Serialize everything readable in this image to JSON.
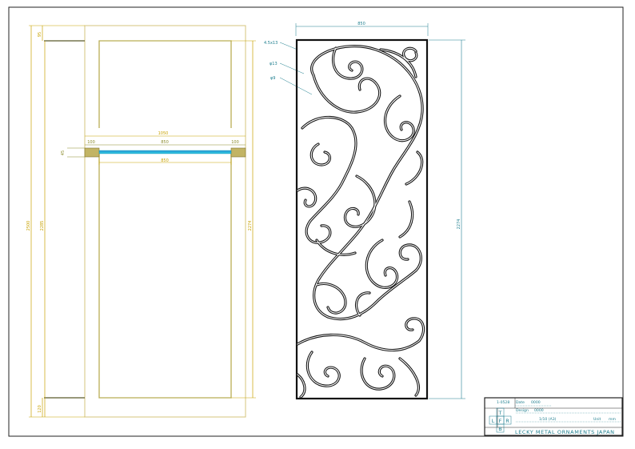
{
  "elevation": {
    "dim_overall_height": "2500",
    "dim_opening_height": "2285",
    "dim_panel_height": "2274",
    "dim_top": "95",
    "dim_bottom": "120",
    "dim_width_overall": "1050",
    "dim_left_jamb": "100",
    "dim_right_jamb": "100",
    "dim_opening_width": "850",
    "dim_inner_width": "850",
    "dim_thickness": "45"
  },
  "panel": {
    "dim_width": "850",
    "dim_height": "2274",
    "callout_bar": "4.5x13",
    "callout_rod1": "φ13",
    "callout_rod2": "φ9"
  },
  "title_block": {
    "drawing_no": "1-0528",
    "row1_label": "Date",
    "row1_value": "0000",
    "row2_label": "Design",
    "row2_value": "0000",
    "scale": "1/10 (A3)",
    "unit_label": "Unit",
    "unit_value": "mm",
    "views": [
      "T",
      "L",
      "F",
      "R",
      "B"
    ],
    "company": "LECKY METAL ORNAMENTS JAPAN"
  }
}
